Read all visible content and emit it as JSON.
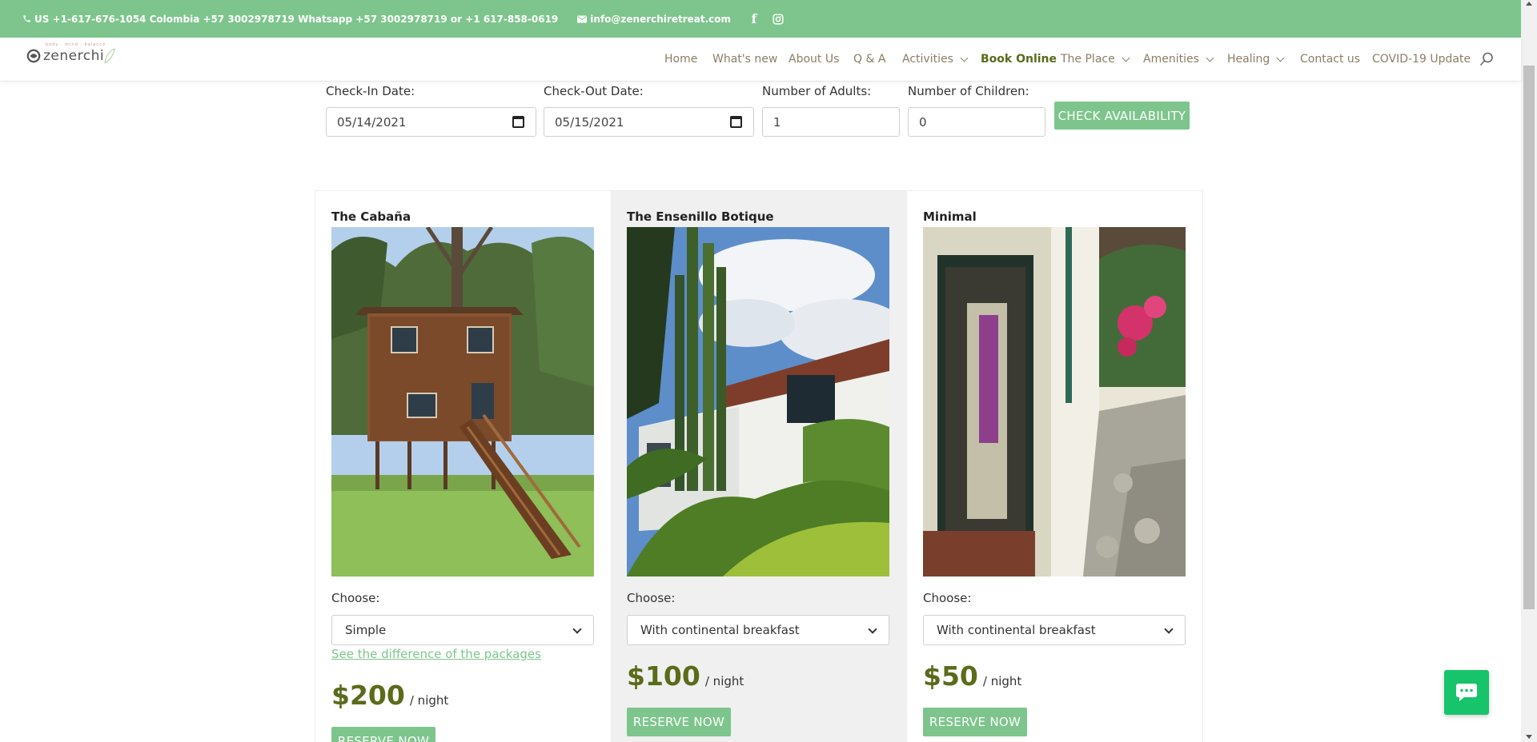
{
  "topbar": {
    "phone": "US +1-617-676-1054 Colombia +57 3002978719 Whatsapp +57 3002978719 or +1 617-858-0619",
    "email": "info@zenerchiretreat.com",
    "social": [
      "facebook-icon",
      "instagram-icon"
    ]
  },
  "header": {
    "logo_text": "zenerchi",
    "logo_tagline": "body · mind · balance",
    "nav": [
      {
        "label": "Home",
        "dropdown": false,
        "active": false
      },
      {
        "label": "What's new",
        "dropdown": false,
        "active": false
      },
      {
        "label": "About Us",
        "dropdown": false,
        "active": false
      },
      {
        "label": "Q & A",
        "dropdown": false,
        "active": false
      },
      {
        "label": "Activities",
        "dropdown": true,
        "active": false
      },
      {
        "label": "Book Online",
        "dropdown": false,
        "active": true
      },
      {
        "label": "The Place",
        "dropdown": true,
        "active": false
      },
      {
        "label": "Amenities",
        "dropdown": true,
        "active": false
      },
      {
        "label": "Healing",
        "dropdown": true,
        "active": false
      },
      {
        "label": "Contact us",
        "dropdown": false,
        "active": false
      },
      {
        "label": "COVID-19 Update",
        "dropdown": false,
        "active": false
      }
    ]
  },
  "booking": {
    "checkin_label": "Check-In Date:",
    "checkin_value": "05/14/2021",
    "checkout_label": "Check-Out Date:",
    "checkout_value": "05/15/2021",
    "adults_label": "Number of Adults:",
    "adults_value": "1",
    "children_label": "Number of Children:",
    "children_value": "0",
    "check_button": "CHECK AVAILABILITY"
  },
  "rooms": [
    {
      "title": "The Cabaña",
      "choose_label": "Choose:",
      "package": "Simple",
      "link": "See the difference of the packages",
      "price": "$200",
      "unit": "/ night",
      "reserve": "RESERVE NOW"
    },
    {
      "title": "The Ensenillo Botique",
      "choose_label": "Choose:",
      "package": "With continental breakfast",
      "price": "$100",
      "unit": "/ night",
      "reserve": "RESERVE NOW"
    },
    {
      "title": "Minimal",
      "choose_label": "Choose:",
      "package": "With continental breakfast",
      "price": "$50",
      "unit": "/ night",
      "reserve": "RESERVE NOW"
    }
  ],
  "colors": {
    "brand_green": "#7dc58c",
    "price_olive": "#5a6b1a",
    "nav_text": "#8a7e66",
    "chat_green": "#18c46b"
  },
  "chat": {
    "icon": "chat-bubble-icon"
  }
}
